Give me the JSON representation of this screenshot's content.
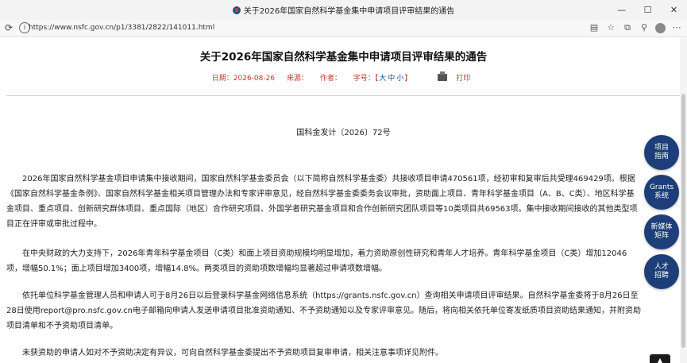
{
  "window": {
    "title": "关于2026年国家自然科学基金集中申请项目评审结果的通告",
    "minimize": "—",
    "maximize": "☐",
    "close": "✕"
  },
  "address_bar": {
    "url": "https://www.nsfc.gov.cn/p1/3381/2822/141011.html",
    "icons": [
      "reload-icon",
      "info-icon",
      "reader-icon",
      "favorite-icon",
      "extensions-icon",
      "collections-icon",
      "profile-icon",
      "more-icon"
    ]
  },
  "article": {
    "title": "关于2026年国家自然科学基金集中申请项目评审结果的通告",
    "date_label": "日期：2026-08-26",
    "source_label": "来源：",
    "author_label": "作者：",
    "font_size_label": "字号：【",
    "size_large": "大",
    "size_medium": "中",
    "size_small": "小",
    "font_size_close": "】",
    "print_label": "打印",
    "doc_number": "国科金发计〔2026〕72号",
    "paragraphs": [
      "2026年国家自然科学基金项目申请集中接收期间，国家自然科学基金委员会（以下简称自然科学基金委）共接收项目申请470561项，经初审和复审后共受理469429项。根据《国家自然科学基金条例》、国家自然科学基金相关项目管理办法和专家评审意见，经自然科学基金委委务会议审批，资助面上项目、青年科学基金项目（A、B、C类）、地区科学基金项目、重点项目、创新研究群体项目、重点国际（地区）合作研究项目、外国学者研究基金项目和合作创新研究团队项目等10类项目共69563项。集中接收期间接收的其他类型项目正在评审或审批过程中。",
      "在中央财政的大力支持下，2026年青年科学基金项目（C类）和面上项目资助规模均明显增加，着力资助原创性研究和青年人才培养。青年科学基金项目（C类）增加12046项，增幅50.1%；面上项目增加3400项，增幅14.8%。两类项目的资助项数增幅均显著超过申请项数增幅。",
      "依托单位科学基金管理人员和申请人可于8月26日以后登录科学基金网络信息系统（https://grants.nsfc.gov.cn）查询相关申请项目评审结果。自然科学基金委将于8月26日至28日使用report@pro.nsfc.gov.cn电子邮箱向申请人发送申请项目批准资助通知、不予资助通知以及专家评审意见。随后，将向相关依托单位寄发纸质项目资助结果通知，并附资助项目清单和不予资助项目清单。",
      "未获资助的申请人如对不予资助决定有异议，可向自然科学基金委提出不予资助项目复审申请，相关注意事项详见附件。"
    ]
  },
  "float_buttons": [
    {
      "label": "项目\n指南"
    },
    {
      "label": "Grants\n系统"
    },
    {
      "label": "新媒体\n矩阵"
    },
    {
      "label": "人才\n招聘"
    }
  ],
  "colors": {
    "meta_red": "#c0392b",
    "link_blue": "#1a4fa0",
    "float_button_navy": "#1d3e78"
  }
}
